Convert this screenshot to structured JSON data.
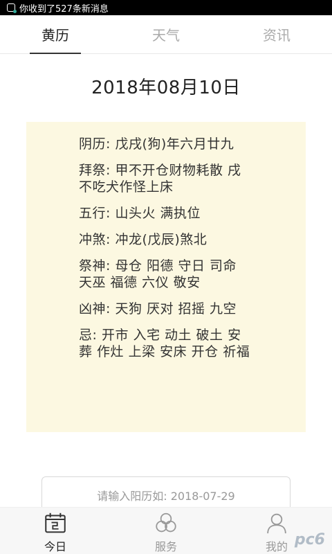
{
  "status_bar": {
    "notification": "你收到了527条新消息"
  },
  "tabs": [
    {
      "label": "黄历",
      "active": true
    },
    {
      "label": "天气",
      "active": false
    },
    {
      "label": "资讯",
      "active": false
    }
  ],
  "date_title": "2018年08月10日",
  "almanac": {
    "lunar": "阴历: 戊戌(狗)年六月廿九",
    "worship": "拜祭: 甲不开仓财物耗散 戌不吃犬作怪上床",
    "five_elements": "五行: 山头火 满执位",
    "clash": "冲煞: 冲龙(戊辰)煞北",
    "lucky_gods": "祭神: 母仓 阳德 守日 司命 天巫 福德 六仪 敬安",
    "evil_gods": "凶神: 天狗 厌对 招摇 九空",
    "avoid": "忌: 开市 入宅 动土 破土 安葬 作灶 上梁 安床 开仓 祈福"
  },
  "date_input": {
    "placeholder": "请输入阳历如: 2018-07-29",
    "value": ""
  },
  "bottom_nav": [
    {
      "label": "今日",
      "icon": "calendar-icon",
      "active": true
    },
    {
      "label": "服务",
      "icon": "rings-icon",
      "active": false
    },
    {
      "label": "我的",
      "icon": "person-icon",
      "active": false
    }
  ],
  "watermark": "pc6"
}
